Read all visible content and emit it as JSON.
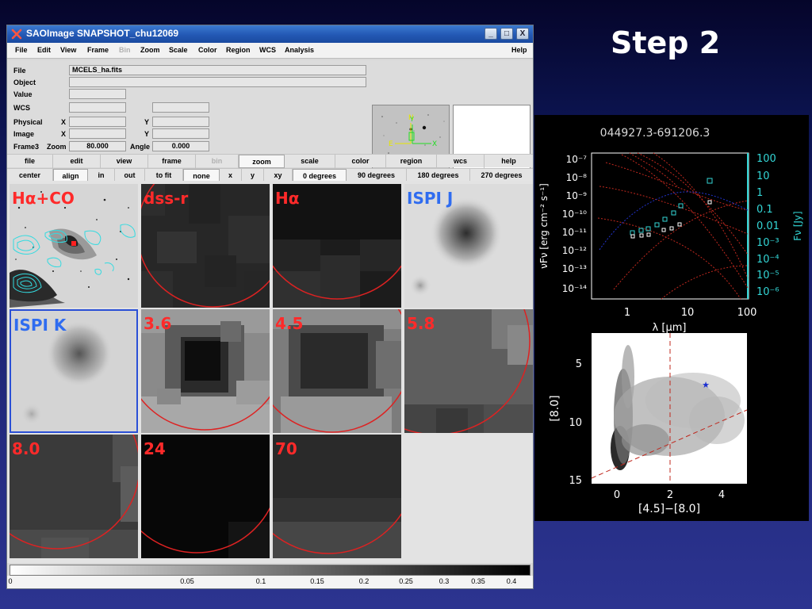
{
  "slide_title": "Step 2",
  "window": {
    "title": "SAOImage SNAPSHOT_chu12069",
    "controls": [
      "_",
      "□",
      "X"
    ]
  },
  "menubar": {
    "items": [
      {
        "label": "File",
        "disabled": false
      },
      {
        "label": "Edit",
        "disabled": false
      },
      {
        "label": "View",
        "disabled": false
      },
      {
        "label": "Frame",
        "disabled": false
      },
      {
        "label": "Bin",
        "disabled": true
      },
      {
        "label": "Zoom",
        "disabled": false
      },
      {
        "label": "Scale",
        "disabled": false
      },
      {
        "label": "Color",
        "disabled": false
      },
      {
        "label": "Region",
        "disabled": false
      },
      {
        "label": "WCS",
        "disabled": false
      },
      {
        "label": "Analysis",
        "disabled": false
      },
      {
        "label": "Help",
        "disabled": false
      }
    ]
  },
  "info": {
    "file_label": "File",
    "file_value": "MCELS_ha.fits",
    "object_label": "Object",
    "value_label": "Value",
    "wcs_label": "WCS",
    "physical_label": "Physical",
    "image_label": "Image",
    "x_label": "X",
    "y_label": "Y",
    "frame_label": "Frame3",
    "zoom_label": "Zoom",
    "zoom_value": "80.000",
    "angle_label": "Angle",
    "angle_value": "0.000"
  },
  "panner": {
    "n_label": "N",
    "e_label": "E",
    "x_label": "X",
    "y_label": "Y"
  },
  "buttonbar": {
    "main": [
      {
        "label": "file",
        "active": false,
        "disabled": false
      },
      {
        "label": "edit",
        "active": false,
        "disabled": false
      },
      {
        "label": "view",
        "active": false,
        "disabled": false
      },
      {
        "label": "frame",
        "active": false,
        "disabled": false
      },
      {
        "label": "bin",
        "active": false,
        "disabled": true
      },
      {
        "label": "zoom",
        "active": true,
        "disabled": false
      },
      {
        "label": "scale",
        "active": false,
        "disabled": false
      },
      {
        "label": "color",
        "active": false,
        "disabled": false
      },
      {
        "label": "region",
        "active": false,
        "disabled": false
      },
      {
        "label": "wcs",
        "active": false,
        "disabled": false
      },
      {
        "label": "help",
        "active": false,
        "disabled": false
      }
    ],
    "sub": [
      {
        "label": "center",
        "active": false
      },
      {
        "label": "align",
        "active": true
      },
      {
        "label": "in",
        "active": false
      },
      {
        "label": "out",
        "active": false
      },
      {
        "label": "to fit",
        "active": false
      },
      {
        "label": "none",
        "active": true
      },
      {
        "label": "x",
        "active": false
      },
      {
        "label": "y",
        "active": false
      },
      {
        "label": "xy",
        "active": false
      },
      {
        "label": "0 degrees",
        "active": true
      },
      {
        "label": "90 degrees",
        "active": false
      },
      {
        "label": "180 degrees",
        "active": false
      },
      {
        "label": "270 degrees",
        "active": false
      }
    ]
  },
  "frames": [
    {
      "label": "Hα+CO",
      "label_color": "#ff2a2a",
      "selected": false
    },
    {
      "label": "dss-r",
      "label_color": "#ff2a2a",
      "selected": false
    },
    {
      "label": "Hα",
      "label_color": "#ff2a2a",
      "selected": false
    },
    {
      "label": "ISPI J",
      "label_color": "#2f6cf0",
      "selected": false
    },
    {
      "label": "ISPI K",
      "label_color": "#2f6cf0",
      "selected": true
    },
    {
      "label": "3.6",
      "label_color": "#ff2a2a",
      "selected": false
    },
    {
      "label": "4.5",
      "label_color": "#ff2a2a",
      "selected": false
    },
    {
      "label": "5.8",
      "label_color": "#ff2a2a",
      "selected": false
    },
    {
      "label": "8.0",
      "label_color": "#ff2a2a",
      "selected": false
    },
    {
      "label": "24",
      "label_color": "#ff2a2a",
      "selected": false
    },
    {
      "label": "70",
      "label_color": "#ff2a2a",
      "selected": false
    }
  ],
  "colorbar": {
    "ticks": [
      {
        "label": "0",
        "value": 0
      },
      {
        "label": "0.05",
        "value": 0.05
      },
      {
        "label": "0.1",
        "value": 0.1
      },
      {
        "label": "0.15",
        "value": 0.15
      },
      {
        "label": "0.2",
        "value": 0.2
      },
      {
        "label": "0.25",
        "value": 0.25
      },
      {
        "label": "0.3",
        "value": 0.3
      },
      {
        "label": "0.35",
        "value": 0.35
      },
      {
        "label": "0.4",
        "value": 0.4
      }
    ]
  },
  "sed_plot": {
    "title": "044927.3-691206.3",
    "xlabel": "λ [μm]",
    "ylabel": "νFν [erg cm⁻² s⁻¹]",
    "y2label": "Fν [Jy]",
    "x_ticks": [
      "1",
      "10",
      "100"
    ],
    "y_ticks": [
      "10⁻⁷",
      "10⁻⁸",
      "10⁻⁹",
      "10⁻¹⁰",
      "10⁻¹¹",
      "10⁻¹²",
      "10⁻¹³",
      "10⁻¹⁴"
    ],
    "y2_ticks": [
      "100",
      "10",
      "1",
      "0.1",
      "0.01",
      "10⁻³",
      "10⁻⁴",
      "10⁻⁵",
      "10⁻⁶"
    ],
    "axis_color": "#33d6d6",
    "model_color": "#c0281e",
    "blue_model_color": "#2233cc"
  },
  "cmd_plot": {
    "xlabel": "[4.5]−[8.0]",
    "ylabel": "[8.0]",
    "x_ticks": [
      "0",
      "2",
      "4"
    ],
    "y_ticks": [
      "5",
      "10",
      "15"
    ],
    "star_color": "#1a2ed0",
    "line_color": "#c0281e"
  },
  "chart_data": [
    {
      "type": "scatter",
      "title": "044927.3-691206.3",
      "xlabel": "λ [μm]",
      "ylabel": "νFν [erg cm⁻² s⁻¹]",
      "xscale": "log",
      "yscale": "log",
      "xlim": [
        0.4,
        100
      ],
      "ylim": [
        1e-14,
        1e-07
      ],
      "series": [
        {
          "marker": "square",
          "color": "#33d6d6",
          "x": [
            1.25,
            1.65,
            2.2,
            3.6,
            4.5,
            5.8,
            8.0,
            24
          ],
          "y": [
            1.4e-11,
            1.6e-11,
            2e-11,
            3e-11,
            6e-11,
            1e-10,
            2.5e-10,
            2.5e-09
          ]
        },
        {
          "marker": "square",
          "color": "#ffffff",
          "x": [
            1.25,
            1.65,
            2.2,
            3.6,
            4.5,
            5.8,
            8.0,
            24
          ],
          "y": [
            1e-11,
            1.1e-11,
            1.2e-11,
            1.5e-11,
            2e-11,
            2.6e-11,
            4e-11,
            2e-10
          ]
        }
      ]
    },
    {
      "type": "scatter",
      "xlabel": "[4.5]−[8.0]",
      "ylabel": "[8.0]",
      "xlim": [
        -1,
        5
      ],
      "ylim": [
        15,
        2
      ],
      "highlight": {
        "x": 3.4,
        "y": 7.0
      },
      "vertical_line_x": 2,
      "diagonal_line": [
        [
          -1,
          15
        ],
        [
          5,
          9.4
        ]
      ]
    }
  ]
}
